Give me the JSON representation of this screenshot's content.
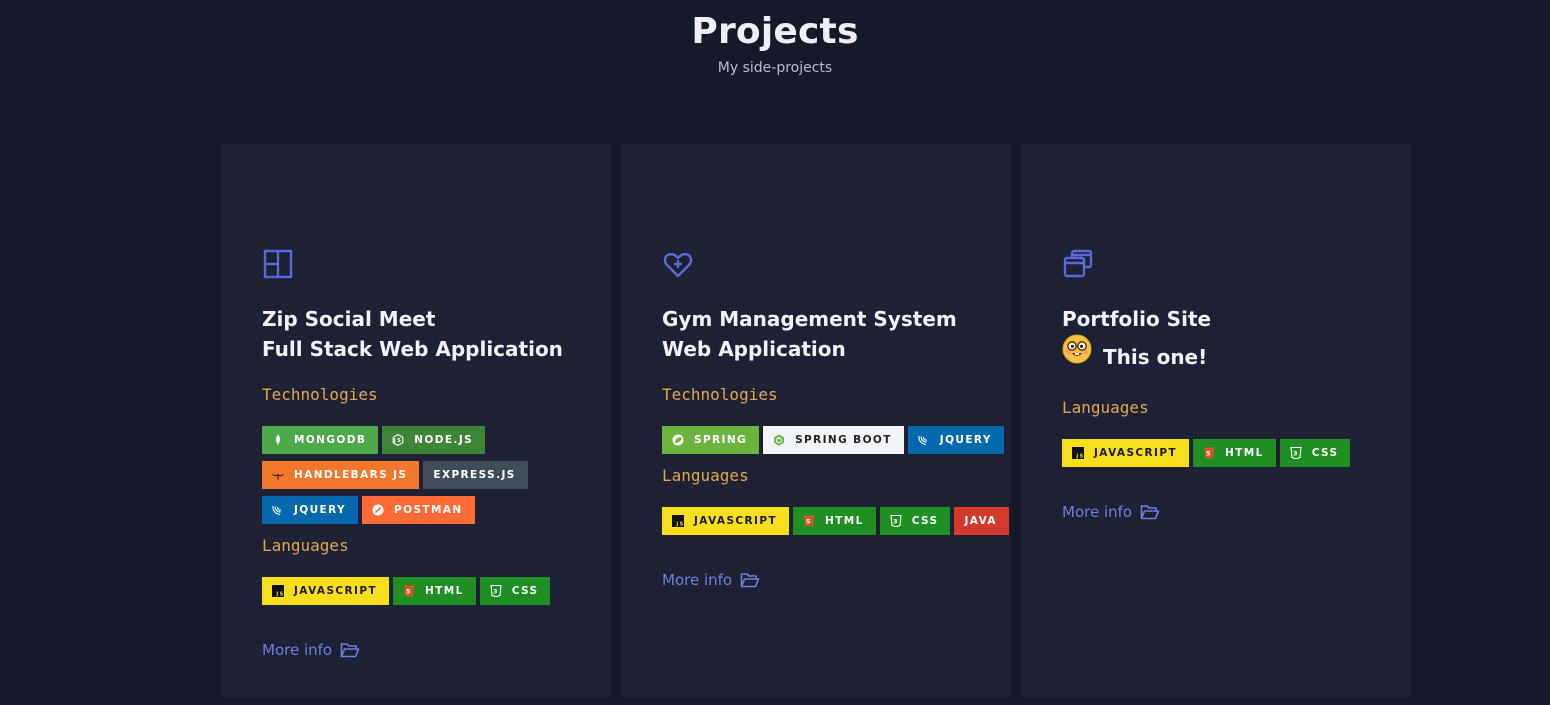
{
  "header": {
    "title": "Projects",
    "subtitle": "My side-projects"
  },
  "colors": {
    "accent": "#6f7ee0",
    "section_label": "#e0a84c",
    "card_bg": "#1d2133",
    "page_bg": "#161927"
  },
  "projects": [
    {
      "icon": "layout-panel-icon",
      "title_lines": [
        "Zip Social Meet",
        "Full Stack Web Application"
      ],
      "technologies_label": "Technologies",
      "technologies": [
        {
          "label": "MONGODB",
          "icon": "mongodb-leaf-icon",
          "bg": "#4ea94b"
        },
        {
          "label": "NODE.JS",
          "icon": "nodejs-hex-icon",
          "bg": "#3d8537"
        },
        {
          "label": "HANDLEBARS JS",
          "icon": "handlebars-mustache-icon",
          "bg": "#f0772b"
        },
        {
          "label": "EXPRESS.JS",
          "icon": "",
          "bg": "#404d59"
        },
        {
          "label": "JQUERY",
          "icon": "jquery-icon",
          "bg": "#0769ad"
        },
        {
          "label": "POSTMAN",
          "icon": "postman-icon",
          "bg": "#ff6c37"
        }
      ],
      "languages_label": "Languages",
      "languages": [
        {
          "label": "JAVASCRIPT",
          "icon": "javascript-icon",
          "bg": "#f7df1e",
          "fg": "#1b1b1b"
        },
        {
          "label": "HTML",
          "icon": "html5-icon",
          "bg": "#1f8f23"
        },
        {
          "label": "CSS",
          "icon": "css3-icon",
          "bg": "#1f8f23"
        }
      ],
      "more_info": "More info"
    },
    {
      "icon": "heart-plus-icon",
      "title_lines": [
        "Gym Management System",
        "Web Application"
      ],
      "technologies_label": "Technologies",
      "technologies": [
        {
          "label": "SPRING",
          "icon": "spring-leaf-icon",
          "bg": "#6db33f"
        },
        {
          "label": "SPRING BOOT",
          "icon": "spring-boot-icon",
          "bg": "#f4f5f8",
          "fg": "#222222"
        },
        {
          "label": "JQUERY",
          "icon": "jquery-icon",
          "bg": "#0769ad"
        }
      ],
      "languages_label": "Languages",
      "languages": [
        {
          "label": "JAVASCRIPT",
          "icon": "javascript-icon",
          "bg": "#f7df1e",
          "fg": "#1b1b1b"
        },
        {
          "label": "HTML",
          "icon": "html5-icon",
          "bg": "#1f8f23"
        },
        {
          "label": "CSS",
          "icon": "css3-icon",
          "bg": "#1f8f23"
        },
        {
          "label": "JAVA",
          "icon": "",
          "bg": "#d33a2c"
        }
      ],
      "more_info": "More info"
    },
    {
      "icon": "stacked-windows-icon",
      "title_lines": [
        "Portfolio Site",
        "This one!"
      ],
      "title_emoji": "nerd-face-emoji-icon",
      "languages_label": "Languages",
      "languages": [
        {
          "label": "JAVASCRIPT",
          "icon": "javascript-icon",
          "bg": "#f7df1e",
          "fg": "#1b1b1b"
        },
        {
          "label": "HTML",
          "icon": "html5-icon",
          "bg": "#1f8f23"
        },
        {
          "label": "CSS",
          "icon": "css3-icon",
          "bg": "#1f8f23"
        }
      ],
      "more_info": "More info"
    }
  ]
}
